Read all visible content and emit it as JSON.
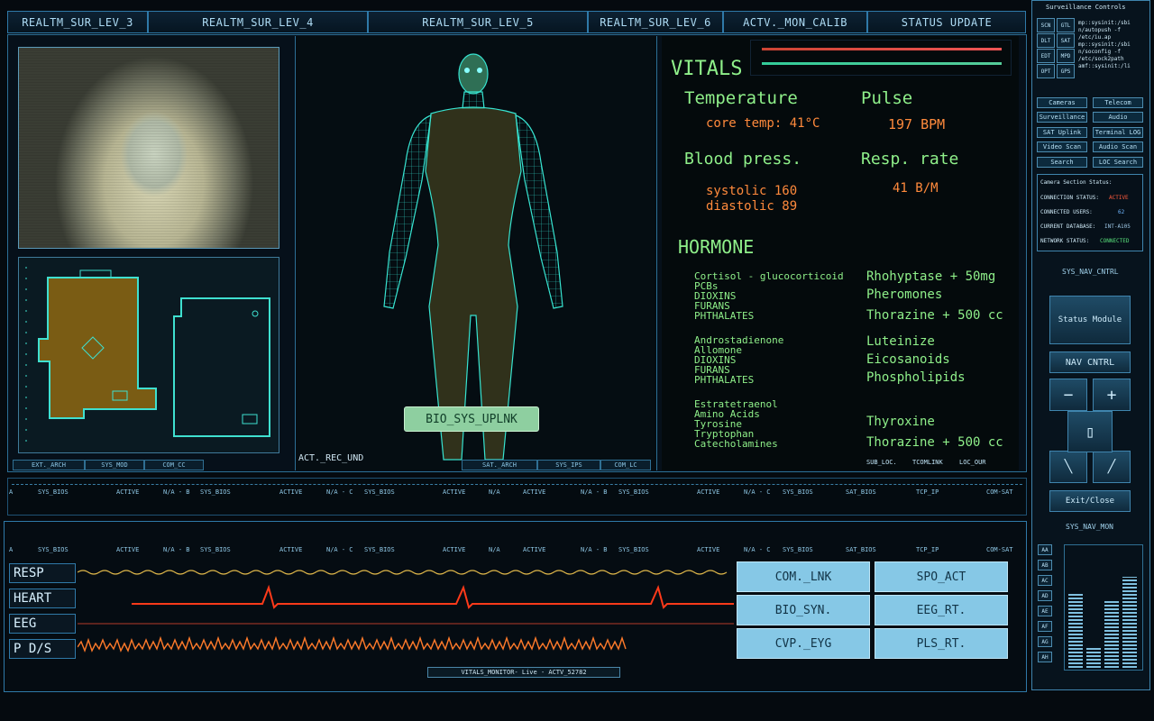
{
  "tabs": [
    "REALTM_SUR_LEV_3",
    "REALTM_SUR_LEV_4",
    "REALTM_SUR_LEV_5",
    "REALTM_SUR_LEV_6",
    "ACTV._MON_CALIB",
    "STATUS UPDATE"
  ],
  "left_subtabs": [
    "EXT._ARCH",
    "SYS_MOD",
    "COM_CC"
  ],
  "body_subtabs": [
    "SAT._ARCH",
    "SYS_IPS",
    "COM_LC"
  ],
  "body_uplink": "BIO_SYS_UPLNK",
  "body_caption": "ACT._REC_UND",
  "vitals": {
    "title": "VITALS",
    "temperature_label": "Temperature",
    "temperature_value": "core temp:  41°C",
    "pulse_label": "Pulse",
    "pulse_value": "197 BPM",
    "blood_label": "Blood press.",
    "systolic": "systolic  160",
    "diastolic": "diastolic  89",
    "resp_label": "Resp. rate",
    "resp_value": "41 B/M"
  },
  "hormone": {
    "title": "HORMONE",
    "group1": [
      "Cortisol - glucocorticoid",
      "PCBs",
      "DIOXINS",
      "FURANS",
      "PHTHALATES"
    ],
    "group2": [
      "Androstadienone",
      "Allomone",
      "DIOXINS",
      "FURANS",
      "PHTHALATES"
    ],
    "group3": [
      "Estratetraenol",
      "Amino Acids",
      "Tyrosine",
      "Tryptophan",
      "Catecholamines"
    ],
    "right1": [
      "Rhohyptase  + 50mg",
      "Pheromones",
      "Thorazine + 500 cc"
    ],
    "right2": [
      "Luteinize",
      "Eicosanoids",
      "Phospholipids"
    ],
    "right3": [
      "Thyroxine",
      "Thorazine + 500 cc"
    ],
    "footer": [
      "SUB_LOC.",
      "TCOMLINK",
      "LOC_OUR"
    ]
  },
  "status_row": [
    "A",
    "SYS_BIOS",
    "ACTIVE",
    "N/A - B",
    "SYS_BIOS",
    "ACTIVE",
    "N/A - C",
    "SYS_BIOS",
    "ACTIVE",
    "N/A",
    "ACTIVE",
    "N/A - B",
    "SYS_BIOS",
    "ACTIVE",
    "N/A - C",
    "SYS_BIOS",
    "SAT_BIOS",
    "TCP_IP",
    "COM-SAT"
  ],
  "monitor": {
    "labels": [
      "RESP",
      "HEART",
      "EEG",
      "P D/S"
    ],
    "buttons": [
      "COM._LNK",
      "SPO_ACT",
      "BIO_SYN.",
      "EEG_RT.",
      "CVP._EYG",
      "PLS_RT."
    ],
    "footer": "VITALS_MONITOR- Live - ACTV_52782"
  },
  "right_panel": {
    "title": "Surveillance Controls",
    "small_buttons": [
      "SCN",
      "GTL",
      "DLT",
      "SAT",
      "EDT",
      "MPD",
      "OPT",
      "GPS"
    ],
    "code_lines": [
      "mp::sysinit:/sbi",
      "n/autopush -f",
      "/etc/iu.ap",
      "mp::sysinit:/sbi",
      "n/soconfig -f",
      "/etc/sock2path",
      "amf::sysinit:/li"
    ],
    "menu": [
      "Cameras",
      "Telecom",
      "Surveillance",
      "Audio",
      "SAT Uplink",
      "Terminal LOG",
      "Video Scan",
      "Audio Scan",
      "Search",
      "LOC Search"
    ],
    "camera_status_title": "Camera Section Status:",
    "camera_status": [
      {
        "label": "CONNECTION STATUS:",
        "value": "ACTIVE",
        "color": "#ff5a3c"
      },
      {
        "label": "CONNECTED USERS:",
        "value": "62",
        "color": "#6fb6ff"
      },
      {
        "label": "CURRENT DATABASE:",
        "value": "INT-A105",
        "color": "#9fc8e6"
      },
      {
        "label": "NETWORK STATUS:",
        "value": "CONNECTED",
        "color": "#58e07a"
      }
    ],
    "nav_title": "SYS_NAV_CNTRL",
    "status_module": "Status Module",
    "nav_cntrl": "NAV CNTRL",
    "minus": "−",
    "plus": "+",
    "exit_close": "Exit/Close",
    "mon_title": "SYS_NAV_MON",
    "channels": [
      "AA",
      "AB",
      "AC",
      "AD",
      "AE",
      "AF",
      "AG",
      "AH"
    ],
    "meter_levels": [
      0.62,
      0.18,
      0.55,
      0.75
    ]
  }
}
